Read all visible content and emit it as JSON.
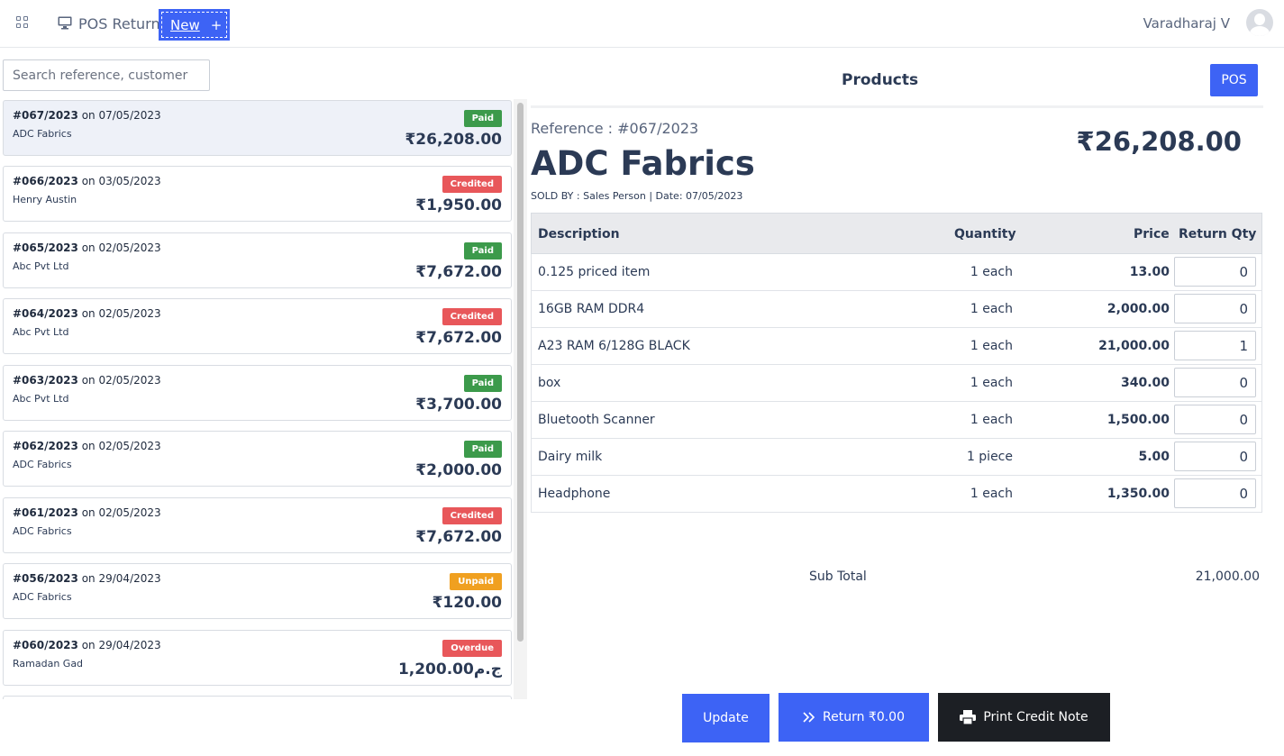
{
  "header": {
    "app_title": "POS Return",
    "new_label": "New",
    "new_icon": "plus-icon",
    "user_name": "Varadharaj V"
  },
  "search": {
    "placeholder": "Search reference, customer"
  },
  "orders": [
    {
      "ref": "#067/2023",
      "date": "on 07/05/2023",
      "customer": "ADC Fabrics",
      "status": "Paid",
      "status_color": "#3c9a4b",
      "amount": "₹26,208.00",
      "active": true
    },
    {
      "ref": "#066/2023",
      "date": "on 03/05/2023",
      "customer": "Henry Austin",
      "status": "Credited",
      "status_color": "#e8575a",
      "amount": "₹1,950.00"
    },
    {
      "ref": "#065/2023",
      "date": "on 02/05/2023",
      "customer": "Abc Pvt Ltd",
      "status": "Paid",
      "status_color": "#3c9a4b",
      "amount": "₹7,672.00"
    },
    {
      "ref": "#064/2023",
      "date": "on 02/05/2023",
      "customer": "Abc Pvt Ltd",
      "status": "Credited",
      "status_color": "#e8575a",
      "amount": "₹7,672.00"
    },
    {
      "ref": "#063/2023",
      "date": "on 02/05/2023",
      "customer": "Abc Pvt Ltd",
      "status": "Paid",
      "status_color": "#3c9a4b",
      "amount": "₹3,700.00"
    },
    {
      "ref": "#062/2023",
      "date": "on 02/05/2023",
      "customer": "ADC Fabrics",
      "status": "Paid",
      "status_color": "#3c9a4b",
      "amount": "₹2,000.00"
    },
    {
      "ref": "#061/2023",
      "date": "on 02/05/2023",
      "customer": "ADC Fabrics",
      "status": "Credited",
      "status_color": "#e8575a",
      "amount": "₹7,672.00"
    },
    {
      "ref": "#056/2023",
      "date": "on 29/04/2023",
      "customer": "ADC Fabrics",
      "status": "Unpaid",
      "status_color": "#f0a020",
      "amount": "₹120.00"
    },
    {
      "ref": "#060/2023",
      "date": "on 29/04/2023",
      "customer": "Ramadan Gad",
      "status": "Overdue",
      "status_color": "#e8575a",
      "amount": "ج.م1,200.00"
    }
  ],
  "detail": {
    "products_title": "Products",
    "pos_label": "POS",
    "reference": "Reference : #067/2023",
    "customer": "ADC Fabrics",
    "total": "₹26,208.00",
    "sold_by": "SOLD BY : Sales Person | Date: 07/05/2023",
    "columns": {
      "description": "Description",
      "quantity": "Quantity",
      "price": "Price",
      "return_qty": "Return Qty"
    },
    "items": [
      {
        "description": "0.125 priced item",
        "quantity": "1 each",
        "price": "13.00",
        "return_qty": "0"
      },
      {
        "description": "16GB RAM DDR4",
        "quantity": "1 each",
        "price": "2,000.00",
        "return_qty": "0"
      },
      {
        "description": "A23 RAM 6/128G BLACK",
        "quantity": "1 each",
        "price": "21,000.00",
        "return_qty": "1"
      },
      {
        "description": "box",
        "quantity": "1 each",
        "price": "340.00",
        "return_qty": "0"
      },
      {
        "description": "Bluetooth Scanner",
        "quantity": "1 each",
        "price": "1,500.00",
        "return_qty": "0"
      },
      {
        "description": "Dairy milk",
        "quantity": "1 piece",
        "price": "5.00",
        "return_qty": "0"
      },
      {
        "description": "Headphone",
        "quantity": "1 each",
        "price": "1,350.00",
        "return_qty": "0"
      }
    ],
    "subtotal_label": "Sub Total",
    "subtotal_value": "21,000.00"
  },
  "actions": {
    "update_label": "Update",
    "return_label": "Return ₹0.00",
    "print_label": "Print Credit Note"
  },
  "colors": {
    "accent": "#3d63f5",
    "dark": "#1c1f24",
    "text": "#2b3a55"
  }
}
